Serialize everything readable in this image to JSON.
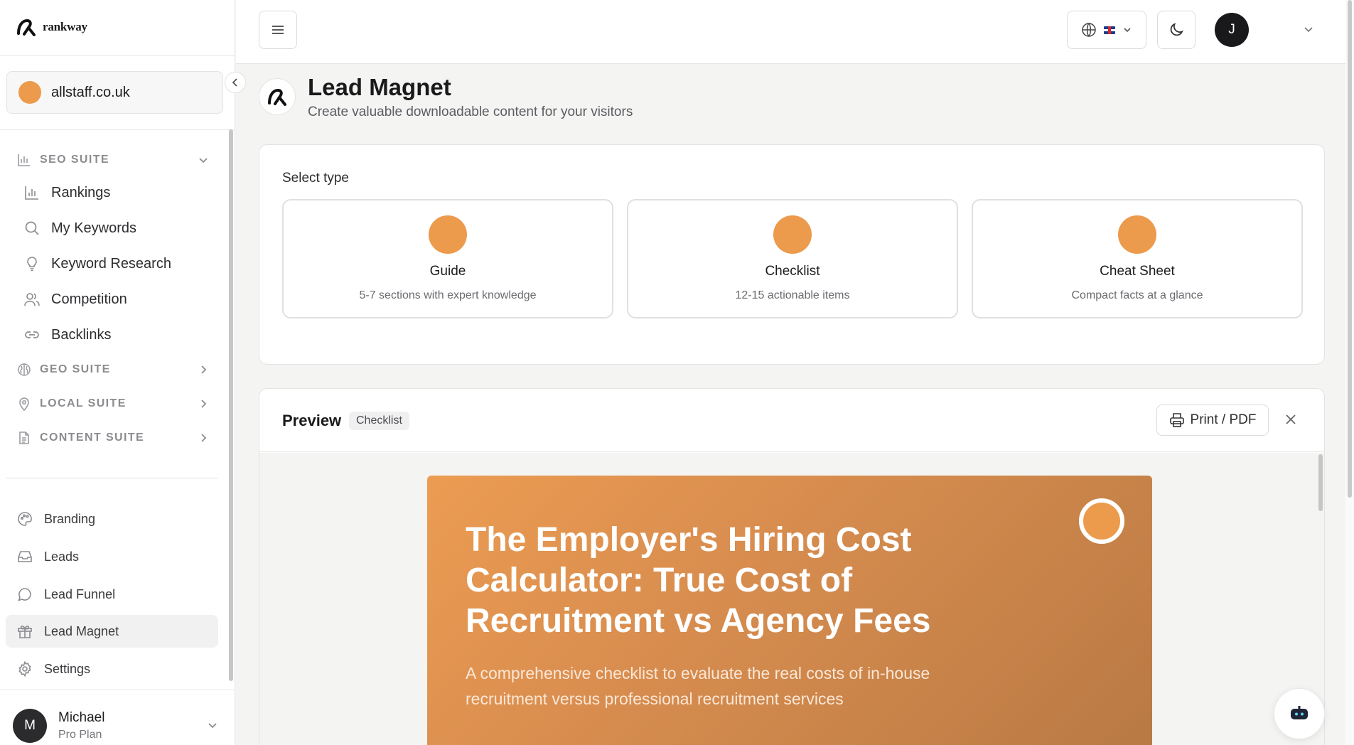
{
  "brand": {
    "name": "rankway"
  },
  "site": {
    "name": "allstaff.co.uk"
  },
  "sidebar": {
    "sections": [
      {
        "label": "SEO SUITE",
        "icon": "bar-chart-icon",
        "expanded": true
      },
      {
        "label": "GEO SUITE",
        "icon": "brain-icon",
        "expanded": false
      },
      {
        "label": "LOCAL SUITE",
        "icon": "map-pin-icon",
        "expanded": false
      },
      {
        "label": "CONTENT SUITE",
        "icon": "document-icon",
        "expanded": false
      }
    ],
    "seo_items": [
      {
        "label": "Rankings",
        "icon": "bar-chart-icon"
      },
      {
        "label": "My Keywords",
        "icon": "search-icon"
      },
      {
        "label": "Keyword Research",
        "icon": "lightbulb-icon"
      },
      {
        "label": "Competition",
        "icon": "users-icon"
      },
      {
        "label": "Backlinks",
        "icon": "link-icon"
      }
    ],
    "bottom_items": [
      {
        "label": "Branding",
        "icon": "palette-icon"
      },
      {
        "label": "Leads",
        "icon": "inbox-icon"
      },
      {
        "label": "Lead Funnel",
        "icon": "chat-icon"
      },
      {
        "label": "Lead Magnet",
        "icon": "gift-icon",
        "active": true
      },
      {
        "label": "Settings",
        "icon": "gear-icon"
      }
    ]
  },
  "user": {
    "initial": "M",
    "name": "Michael",
    "plan": "Pro Plan"
  },
  "topbar": {
    "avatar_initial": "J"
  },
  "page": {
    "title": "Lead Magnet",
    "subtitle": "Create valuable downloadable content for your visitors"
  },
  "type_select": {
    "label": "Select type",
    "options": [
      {
        "name": "Guide",
        "desc": "5-7 sections with expert knowledge"
      },
      {
        "name": "Checklist",
        "desc": "12-15 actionable items"
      },
      {
        "name": "Cheat Sheet",
        "desc": "Compact facts at a glance"
      }
    ]
  },
  "preview": {
    "title": "Preview",
    "badge": "Checklist",
    "print_label": "Print / PDF",
    "hero_title": "The Employer's Hiring Cost Calculator: True Cost of Recruitment vs Agency Fees",
    "hero_subtitle": "A comprehensive checklist to evaluate the real costs of in-house recruitment versus professional recruitment services"
  },
  "colors": {
    "accent": "#ec9a4c",
    "hero_end": "#b87943"
  }
}
